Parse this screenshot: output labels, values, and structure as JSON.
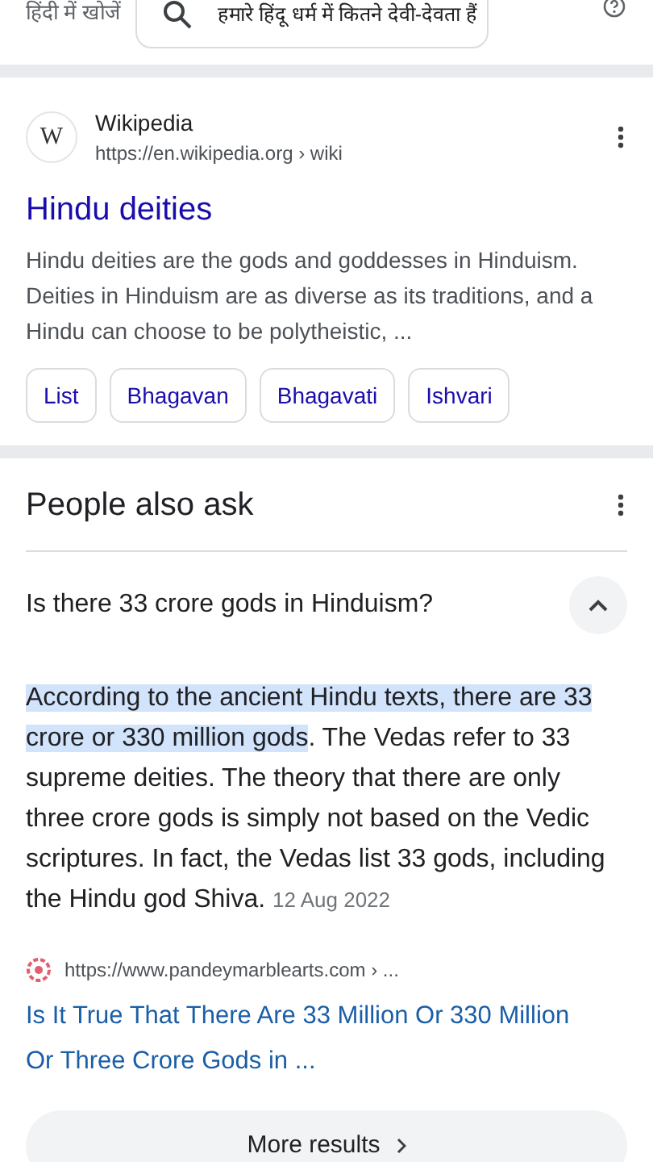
{
  "header": {
    "lang_link": "हिंदी में खोजें",
    "search": {
      "value": "हमारे हिंदू धर्म में कितने देवी-देवता हैं"
    }
  },
  "result": {
    "site": "Wikipedia",
    "url": "https://en.wikipedia.org › wiki",
    "favicon": "W",
    "title": "Hindu deities",
    "snippet": "Hindu deities are the gods and goddesses in Hinduism. Deities in Hinduism are as diverse as its traditions, and a Hindu can choose to be polytheistic, ...",
    "chips": [
      "List",
      "Bhagavan",
      "Bhagavati",
      "Ishvari"
    ]
  },
  "people_also_ask": {
    "title": "People also ask",
    "questions": [
      {
        "question": "Is there 33 crore gods in Hinduism?",
        "expanded": true,
        "answer_highlight": "According to the ancient Hindu texts, there are 33 crore or 330 million gods",
        "answer_rest": ". The Vedas refer to 33 supreme deities. The theory that there are only three crore gods is simply not based on the Vedic scriptures. In fact, the Vedas list 33 gods, including the Hindu god Shiva.",
        "date": "12 Aug 2022",
        "source_url": "https://www.pandeymarblearts.com › ...",
        "source_title": "Is It True That There Are 33 Million Or 330 Million Or Three Crore Gods in ..."
      }
    ],
    "more": "More results"
  }
}
